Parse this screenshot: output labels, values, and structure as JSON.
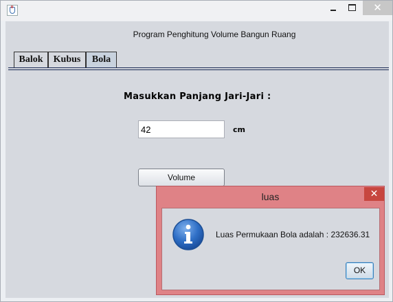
{
  "window": {
    "min_glyph": "",
    "max_glyph": "",
    "close_glyph": "✕"
  },
  "main": {
    "header_title": "Program Penghitung Volume Bangun Ruang",
    "tabs": [
      {
        "label": "Balok"
      },
      {
        "label": "Kubus"
      },
      {
        "label": "Bola"
      }
    ],
    "selected_tab": "Bola",
    "prompt_label": "Masukkan Panjang Jari-Jari :",
    "radius_input": {
      "value": "42"
    },
    "unit_label": "cm",
    "volume_button": "Volume"
  },
  "dialog": {
    "title": "luas",
    "close_glyph": "✕",
    "message": "Luas Permukaan Bola adalah : 232636.31",
    "ok_button": "OK",
    "icon": "info-icon"
  },
  "colors": {
    "dialog_frame": "#df8286",
    "dialog_close": "#c7463f",
    "panel_bg": "#d6d9df"
  }
}
